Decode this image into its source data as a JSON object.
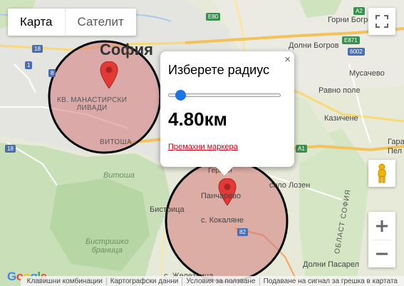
{
  "map_type": {
    "map": "Карта",
    "satellite": "Сателит",
    "selected": "Карта"
  },
  "popup": {
    "title": "Изберете радиус",
    "value": "4.80км",
    "slider_fraction": 0.07,
    "remove_label": "Премахни маркера",
    "close_symbol": "×"
  },
  "labels": {
    "sofia": "София",
    "manastirski": "КВ. МАНАСТИРСКИ\nЛИВАДИ",
    "vitosha_district": "ВИТОША",
    "vitosha": "Витоша",
    "bistritsa": "Бистрица",
    "bistrishko": "Бистришко\nбраница",
    "pancharevo": "Панчарево",
    "kokalyane": "с. Кокаляне",
    "lozen": "село Лозен",
    "gorni_bogrov": "Горни Богров",
    "dolni_bogrov": "Долни Богров",
    "musachevo": "Мусачево",
    "ravno_pole": "Равно поле",
    "kazichene": "Казичене",
    "gara_belovo": "Гара Б",
    "pelo": "Пел",
    "oblast": "ОБЛАСТ СОФИЯ",
    "herman": "Герман",
    "dolni_pasarel": "Долни Пасарел",
    "zheleznitsa": "с. Железница"
  },
  "shields": {
    "e80": "E80",
    "a2": "A2",
    "e871": "E871",
    "n6002": "6002",
    "n18a": "18",
    "n18b": "18",
    "n82": "82",
    "n8": "8",
    "n1": "1",
    "a1": "A1"
  },
  "footer": {
    "items": [
      "Клавишни комбинации",
      "Картографски данни",
      "Условия за ползване",
      "Подаване на сигнал за грешка в картата"
    ]
  },
  "google_logo": "Google",
  "colors": {
    "circle_fill": "#d47a7a",
    "circle_stroke": "#000000",
    "marker": "#e53935",
    "accent": "#1a73e8",
    "remove": "#d0021b"
  }
}
